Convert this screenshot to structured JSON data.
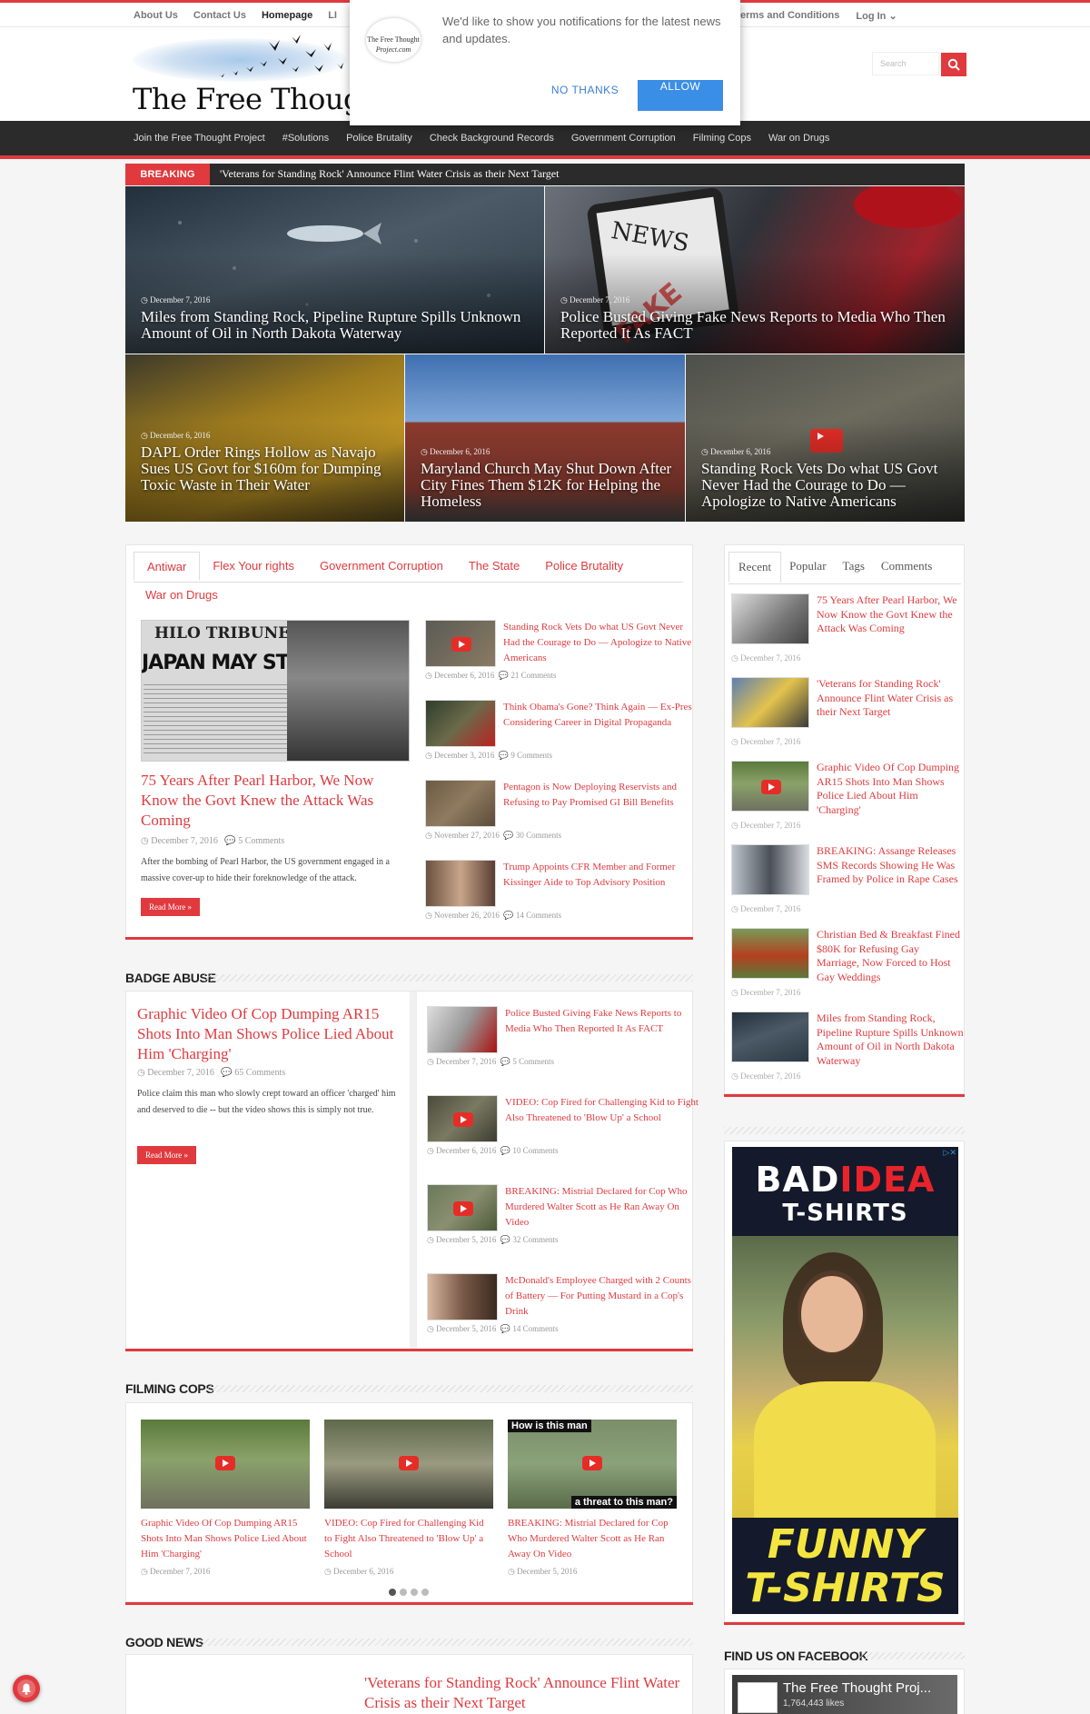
{
  "topbar": {
    "links": [
      "About Us",
      "Contact Us",
      "Homepage",
      "LI"
    ],
    "right_links": [
      "erms and Conditions",
      "Log In"
    ]
  },
  "header": {
    "logo_text": "The Free Thought",
    "search_placeholder": "Search"
  },
  "notification": {
    "logo_line1": "The Free Thought",
    "logo_line2": "Project.com",
    "message": "We'd like to show you notifications for the latest news and updates.",
    "no_thanks": "NO THANKS",
    "allow": "ALLOW"
  },
  "mainnav": [
    "Join the Free Thought Project",
    "#Solutions",
    "Police Brutality",
    "Check Background Records",
    "Government Corruption",
    "Filming Cops",
    "War on Drugs"
  ],
  "breaking": {
    "label": "BREAKING NEWS",
    "text": "'Veterans for Standing Rock' Announce Flint Water Crisis as their Next Target"
  },
  "slider": [
    {
      "date": "December 7, 2016",
      "title": "Miles from Standing Rock, Pipeline Rupture Spills Unknown Amount of Oil in North Dakota Waterway"
    },
    {
      "date": "December 7, 2016",
      "title": "Police Busted Giving Fake News Reports to Media Who Then Reported It As FACT"
    },
    {
      "date": "December 6, 2016",
      "title": "DAPL Order Rings Hollow as Navajo Sues US Govt for $160m for Dumping Toxic Waste in Their Water"
    },
    {
      "date": "December 6, 2016",
      "title": "Maryland Church May Shut Down After City Fines Them $12K for Helping the Homeless"
    },
    {
      "date": "December 6, 2016",
      "title": "Standing Rock Vets Do what US Govt Never Had the Courage to Do — Apologize to Native Americans"
    }
  ],
  "tabs_box": {
    "tabs": [
      "Antiwar",
      "Flex Your rights",
      "Government Corruption",
      "The State",
      "Police Brutality",
      "War on Drugs"
    ],
    "main": {
      "newspaper_header": "HILO TRIBUNE HERALD",
      "newspaper_headline": "JAPAN MAY STRIKE OVER WE",
      "title": "75 Years After Pearl Harbor, We Now Know the Govt Knew the Attack Was Coming",
      "date": "December 7, 2016",
      "comments": "5 Comments",
      "excerpt": "After the bombing of Pearl Harbor, the US government engaged in a massive cover-up to hide their foreknowledge of the attack.",
      "read_more": "Read More »"
    },
    "list": [
      {
        "title": "Standing Rock Vets Do what US Govt Never Had the Courage to Do — Apologize to Native Americans",
        "date": "December 6, 2016",
        "comments": "21 Comments"
      },
      {
        "title": "Think Obama's Gone? Think Again — Ex-Pres Considering Career in Digital Propaganda",
        "date": "December 3, 2016",
        "comments": "9 Comments"
      },
      {
        "title": "Pentagon is Now Deploying Reservists and Refusing to Pay Promised GI Bill Benefits",
        "date": "November 27, 2016",
        "comments": "30 Comments"
      },
      {
        "title": "Trump Appoints CFR Member and Former Kissinger Aide to Top Advisory Position",
        "date": "November 26, 2016",
        "comments": "14 Comments"
      }
    ]
  },
  "badge_abuse": {
    "heading": "BADGE ABUSE",
    "main": {
      "title": "Graphic Video Of Cop Dumping AR15 Shots Into Man Shows Police Lied About Him 'Charging'",
      "date": "December 7, 2016",
      "comments": "65 Comments",
      "excerpt": "Police claim this man who slowly crept toward an officer 'charged' him and deserved to die -- but the video shows this is simply not true.",
      "read_more": "Read More »"
    },
    "list": [
      {
        "title": "Police Busted Giving Fake News Reports to Media Who Then Reported It As FACT",
        "date": "December 7, 2016",
        "comments": "5 Comments"
      },
      {
        "title": "VIDEO: Cop Fired for Challenging Kid to Fight Also Threatened to 'Blow Up' a School",
        "date": "December 6, 2016",
        "comments": "10 Comments"
      },
      {
        "title": "BREAKING: Mistrial Declared for Cop Who Murdered Walter Scott as He Ran Away On Video",
        "date": "December 5, 2016",
        "comments": "32 Comments"
      },
      {
        "title": "McDonald's Employee Charged with 2 Counts of Battery — For Putting Mustard in a Cop's Drink",
        "date": "December 5, 2016",
        "comments": "14 Comments"
      }
    ]
  },
  "filming_cops": {
    "heading": "FILMING COPS",
    "items": [
      {
        "title": "Graphic Video Of Cop Dumping AR15 Shots Into Man Shows Police Lied About Him 'Charging'",
        "date": "December 7, 2016"
      },
      {
        "title": "VIDEO: Cop Fired for Challenging Kid to Fight Also Threatened to 'Blow Up' a School",
        "date": "December 6, 2016"
      },
      {
        "title": "BREAKING: Mistrial Declared for Cop Who Murdered Walter Scott as He Ran Away On Video",
        "date": "December 5, 2016",
        "overlay_top": "How is this man",
        "overlay_bottom": "a threat to this man?"
      }
    ]
  },
  "good_news": {
    "heading": "GOOD NEWS",
    "title": "'Veterans for Standing Rock' Announce Flint Water Crisis as their Next Target"
  },
  "sidebar": {
    "tabs": [
      "Recent",
      "Popular",
      "Tags",
      "Comments"
    ],
    "items": [
      {
        "title": "75 Years After Pearl Harbor, We Now Know the Govt Knew the Attack Was Coming",
        "date": "December 7, 2016"
      },
      {
        "title": "'Veterans for Standing Rock' Announce Flint Water Crisis as their Next Target",
        "date": "December 7, 2016"
      },
      {
        "title": "Graphic Video Of Cop Dumping AR15 Shots Into Man Shows Police Lied About Him 'Charging'",
        "date": "December 7, 2016"
      },
      {
        "title": "BREAKING: Assange Releases SMS Records Showing He Was Framed by Police in Rape Cases",
        "date": "December 7, 2016"
      },
      {
        "title": "Christian Bed & Breakfast Fined $80K for Refusing Gay Marriage, Now Forced to Host Gay Weddings",
        "date": "December 7, 2016"
      },
      {
        "title": "Miles from Standing Rock, Pipeline Rupture Spills Unknown Amount of Oil in North Dakota Waterway",
        "date": "December 7, 2016"
      }
    ],
    "ad": {
      "line1a": "BAD",
      "line1b": "IDEA",
      "line2": "T-SHIRTS",
      "bottom1": "FUNNY",
      "bottom2": "T-SHIRTS"
    },
    "facebook_heading": "FIND US ON FACEBOOK",
    "facebook_page": "The Free Thought Proj...",
    "facebook_likes": "1,764,443 likes"
  },
  "colors": {
    "accent": "#e03a3e",
    "nav": "#2b2b2b"
  }
}
